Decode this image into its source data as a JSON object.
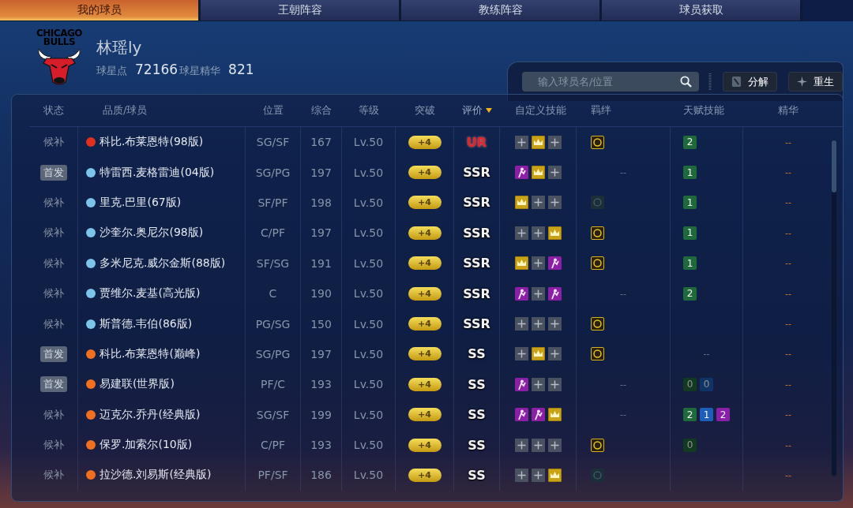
{
  "tabs": [
    {
      "label": "我的球员",
      "selected": true
    },
    {
      "label": "王朝阵容",
      "selected": false
    },
    {
      "label": "教练阵容",
      "selected": false
    },
    {
      "label": "球员获取",
      "selected": false
    }
  ],
  "team": {
    "logo_line_1": "CHICAGO",
    "logo_line_2": "BULLS",
    "name": "林瑶ly",
    "points_label": "球星点",
    "points": "72166",
    "essence_label": "球星精华",
    "essence": "821"
  },
  "search": {
    "placeholder": "输入球员名/位置"
  },
  "buttons": [
    {
      "label": "分解",
      "kind": "disassemble"
    },
    {
      "label": "重生",
      "kind": "rebirth"
    }
  ],
  "columns": [
    {
      "label": "状态",
      "sorted": false
    },
    {
      "label": "品质/球员",
      "sorted": false
    },
    {
      "label": "位置",
      "sorted": false
    },
    {
      "label": "综合",
      "sorted": false
    },
    {
      "label": "等级",
      "sorted": false
    },
    {
      "label": "突破",
      "sorted": false
    },
    {
      "label": "评价",
      "sorted": true
    },
    {
      "label": "自定义技能",
      "sorted": false
    },
    {
      "label": "羁绊",
      "sorted": false
    },
    {
      "label": "天赋技能",
      "sorted": false
    },
    {
      "label": "精华",
      "sorted": false
    }
  ],
  "rows": [
    {
      "status": "候补",
      "starter": false,
      "color": "#e0301e",
      "name": "科比.布莱恩特(98版)",
      "position": "SG/SF",
      "overall": "167",
      "level": "Lv.50",
      "breakthrough": "+4",
      "rating": {
        "text": "UR",
        "kind": "ur"
      },
      "skills": [
        {
          "kind": "empty"
        },
        {
          "kind": "crown"
        },
        {
          "kind": "empty"
        }
      ],
      "bond": {
        "kind": "gold"
      },
      "talents": [
        {
          "value": "2",
          "kind": "green",
          "dim": false
        }
      ],
      "essence": "--"
    },
    {
      "status": "首发",
      "starter": true,
      "color": "#7cc4ea",
      "name": "特雷西.麦格雷迪(04版)",
      "position": "SG/PG",
      "overall": "197",
      "level": "Lv.50",
      "breakthrough": "+4",
      "rating": {
        "text": "SSR",
        "kind": "normal"
      },
      "skills": [
        {
          "kind": "purple"
        },
        {
          "kind": "crown"
        },
        {
          "kind": "empty"
        }
      ],
      "bond_text": "--",
      "talents": [
        {
          "value": "1",
          "kind": "green",
          "dim": false
        }
      ],
      "essence": "--"
    },
    {
      "status": "候补",
      "starter": false,
      "color": "#7cc4ea",
      "name": "里克.巴里(67版)",
      "position": "SF/PF",
      "overall": "198",
      "level": "Lv.50",
      "breakthrough": "+4",
      "rating": {
        "text": "SSR",
        "kind": "normal"
      },
      "skills": [
        {
          "kind": "crown"
        },
        {
          "kind": "empty"
        },
        {
          "kind": "empty"
        }
      ],
      "bond": {
        "kind": "dim"
      },
      "talents": [
        {
          "value": "1",
          "kind": "green",
          "dim": false
        }
      ],
      "essence": "--"
    },
    {
      "status": "候补",
      "starter": false,
      "color": "#7cc4ea",
      "name": "沙奎尔.奥尼尔(98版)",
      "position": "C/PF",
      "overall": "197",
      "level": "Lv.50",
      "breakthrough": "+4",
      "rating": {
        "text": "SSR",
        "kind": "normal"
      },
      "skills": [
        {
          "kind": "empty"
        },
        {
          "kind": "empty"
        },
        {
          "kind": "crown"
        }
      ],
      "bond": {
        "kind": "gold"
      },
      "talents": [
        {
          "value": "1",
          "kind": "green",
          "dim": false
        }
      ],
      "essence": "--"
    },
    {
      "status": "候补",
      "starter": false,
      "color": "#7cc4ea",
      "name": "多米尼克.威尔金斯(88版)",
      "position": "SF/SG",
      "overall": "191",
      "level": "Lv.50",
      "breakthrough": "+4",
      "rating": {
        "text": "SSR",
        "kind": "normal"
      },
      "skills": [
        {
          "kind": "crown"
        },
        {
          "kind": "empty"
        },
        {
          "kind": "purple"
        }
      ],
      "bond": {
        "kind": "gold"
      },
      "talents": [
        {
          "value": "1",
          "kind": "green",
          "dim": false
        }
      ],
      "essence": "--"
    },
    {
      "status": "候补",
      "starter": false,
      "color": "#7cc4ea",
      "name": "贾维尔.麦基(高光版)",
      "position": "C",
      "overall": "190",
      "level": "Lv.50",
      "breakthrough": "+4",
      "rating": {
        "text": "SSR",
        "kind": "normal"
      },
      "skills": [
        {
          "kind": "purple"
        },
        {
          "kind": "empty"
        },
        {
          "kind": "purple"
        }
      ],
      "bond_text": "--",
      "talents": [
        {
          "value": "2",
          "kind": "green",
          "dim": false
        }
      ],
      "essence": "--"
    },
    {
      "status": "候补",
      "starter": false,
      "color": "#7cc4ea",
      "name": "斯普德.韦伯(86版)",
      "position": "PG/SG",
      "overall": "150",
      "level": "Lv.50",
      "breakthrough": "+4",
      "rating": {
        "text": "SSR",
        "kind": "normal"
      },
      "skills": [
        {
          "kind": "empty"
        },
        {
          "kind": "empty"
        },
        {
          "kind": "empty"
        }
      ],
      "bond": {
        "kind": "gold"
      },
      "essence": "--"
    },
    {
      "status": "首发",
      "starter": true,
      "color": "#f07020",
      "name": "科比.布莱恩特(巅峰)",
      "position": "SG/PG",
      "overall": "197",
      "level": "Lv.50",
      "breakthrough": "+4",
      "rating": {
        "text": "SS",
        "kind": "normal"
      },
      "skills": [
        {
          "kind": "empty"
        },
        {
          "kind": "crown"
        },
        {
          "kind": "empty"
        }
      ],
      "bond": {
        "kind": "gold"
      },
      "talent_text": "--",
      "essence": "--"
    },
    {
      "status": "首发",
      "starter": true,
      "color": "#f07020",
      "name": "易建联(世界版)",
      "position": "PF/C",
      "overall": "193",
      "level": "Lv.50",
      "breakthrough": "+4",
      "rating": {
        "text": "SS",
        "kind": "normal"
      },
      "skills": [
        {
          "kind": "purple"
        },
        {
          "kind": "empty"
        },
        {
          "kind": "empty"
        }
      ],
      "bond_text": "--",
      "talents": [
        {
          "value": "0",
          "kind": "green",
          "dim": true
        },
        {
          "value": "0",
          "kind": "blue",
          "dim": true
        }
      ],
      "essence": "--"
    },
    {
      "status": "候补",
      "starter": false,
      "color": "#f07020",
      "name": "迈克尔.乔丹(经典版)",
      "position": "SG/SF",
      "overall": "199",
      "level": "Lv.50",
      "breakthrough": "+4",
      "rating": {
        "text": "SS",
        "kind": "normal"
      },
      "skills": [
        {
          "kind": "purple"
        },
        {
          "kind": "purple"
        },
        {
          "kind": "crown"
        }
      ],
      "bond_text": "--",
      "talents": [
        {
          "value": "2",
          "kind": "green",
          "dim": false
        },
        {
          "value": "1",
          "kind": "blue",
          "dim": false
        },
        {
          "value": "2",
          "kind": "purple",
          "dim": false
        }
      ],
      "essence": "--"
    },
    {
      "status": "候补",
      "starter": false,
      "color": "#f07020",
      "name": "保罗.加索尔(10版)",
      "position": "C/PF",
      "overall": "193",
      "level": "Lv.50",
      "breakthrough": "+4",
      "rating": {
        "text": "SS",
        "kind": "normal"
      },
      "skills": [
        {
          "kind": "empty"
        },
        {
          "kind": "empty"
        },
        {
          "kind": "empty"
        }
      ],
      "bond": {
        "kind": "gold"
      },
      "talents": [
        {
          "value": "0",
          "kind": "green",
          "dim": true
        }
      ],
      "essence": "--"
    },
    {
      "status": "候补",
      "starter": false,
      "color": "#f07020",
      "name": "拉沙德.刘易斯(经典版)",
      "position": "PF/SF",
      "overall": "186",
      "level": "Lv.50",
      "breakthrough": "+4",
      "rating": {
        "text": "SS",
        "kind": "normal"
      },
      "skills": [
        {
          "kind": "empty"
        },
        {
          "kind": "empty"
        },
        {
          "kind": "crown"
        }
      ],
      "bond": {
        "kind": "dim"
      },
      "essence": "--"
    }
  ]
}
